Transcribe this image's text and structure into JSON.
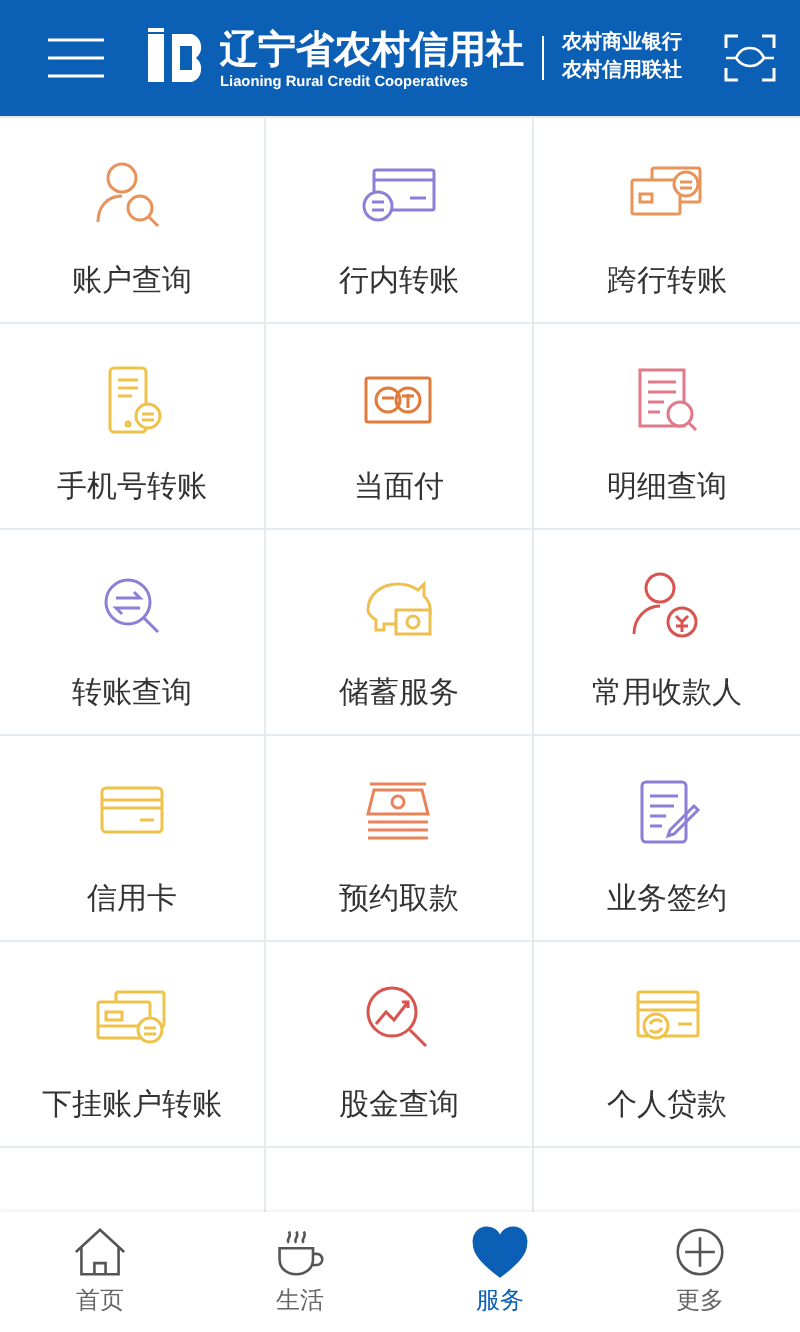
{
  "header": {
    "title": "辽宁省农村信用社",
    "subtitle": "Liaoning Rural Credit Cooperatives",
    "side_lines": [
      "农村商业银行",
      "农村信用联社"
    ]
  },
  "services": [
    {
      "label": "账户查询"
    },
    {
      "label": "行内转账"
    },
    {
      "label": "跨行转账"
    },
    {
      "label": "手机号转账"
    },
    {
      "label": "当面付"
    },
    {
      "label": "明细查询"
    },
    {
      "label": "转账查询"
    },
    {
      "label": "储蓄服务"
    },
    {
      "label": "常用收款人"
    },
    {
      "label": "信用卡"
    },
    {
      "label": "预约取款"
    },
    {
      "label": "业务签约"
    },
    {
      "label": "下挂账户转账"
    },
    {
      "label": "股金查询"
    },
    {
      "label": "个人贷款"
    }
  ],
  "tab_bar": [
    {
      "label": "首页",
      "selected": false
    },
    {
      "label": "生活",
      "selected": false
    },
    {
      "label": "服务",
      "selected": true
    },
    {
      "label": "更多",
      "selected": false
    }
  ]
}
